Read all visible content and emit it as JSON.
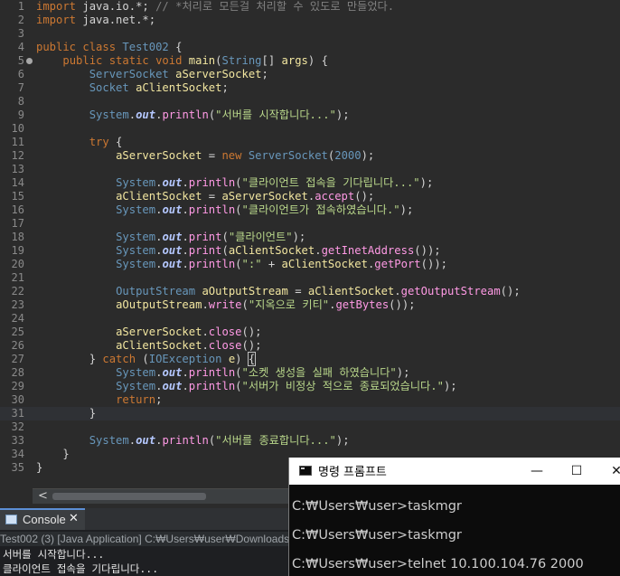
{
  "editor": {
    "lines": [
      {
        "n": "1",
        "tokens": [
          [
            "kw",
            "import"
          ],
          [
            "p",
            " java.io.*; "
          ],
          [
            "cm",
            "// *처리로 모든걸 처리할 수 있도로 만들었다."
          ]
        ]
      },
      {
        "n": "2",
        "tokens": [
          [
            "kw",
            "import"
          ],
          [
            "p",
            " java.net.*;"
          ]
        ]
      },
      {
        "n": "3",
        "tokens": []
      },
      {
        "n": "4",
        "tokens": [
          [
            "kw",
            "public class "
          ],
          [
            "cls",
            "Test002"
          ],
          [
            "p",
            " {"
          ]
        ]
      },
      {
        "n": "5",
        "fold": true,
        "tokens": [
          [
            "p",
            "    "
          ],
          [
            "kw",
            "public static void "
          ],
          [
            "id",
            "main"
          ],
          [
            "p",
            "("
          ],
          [
            "cls",
            "String"
          ],
          [
            "p",
            "[] "
          ],
          [
            "id",
            "args"
          ],
          [
            "p",
            ") {"
          ]
        ]
      },
      {
        "n": "6",
        "tokens": [
          [
            "p",
            "        "
          ],
          [
            "cls",
            "ServerSocket"
          ],
          [
            "p",
            " "
          ],
          [
            "id",
            "aServerSocket"
          ],
          [
            "p",
            ";"
          ]
        ]
      },
      {
        "n": "7",
        "tokens": [
          [
            "p",
            "        "
          ],
          [
            "cls",
            "Socket"
          ],
          [
            "p",
            " "
          ],
          [
            "id",
            "aClientSocket"
          ],
          [
            "p",
            ";"
          ]
        ]
      },
      {
        "n": "8",
        "tokens": []
      },
      {
        "n": "9",
        "tokens": [
          [
            "p",
            "        "
          ],
          [
            "cls",
            "System"
          ],
          [
            "p",
            "."
          ],
          [
            "fld",
            "out"
          ],
          [
            "p",
            "."
          ],
          [
            "mth",
            "println"
          ],
          [
            "p",
            "("
          ],
          [
            "str",
            "\"서버를 시작합니다...\""
          ],
          [
            "p",
            ");"
          ]
        ]
      },
      {
        "n": "10",
        "tokens": []
      },
      {
        "n": "11",
        "tokens": [
          [
            "p",
            "        "
          ],
          [
            "kw",
            "try"
          ],
          [
            "p",
            " {"
          ]
        ]
      },
      {
        "n": "12",
        "tokens": [
          [
            "p",
            "            "
          ],
          [
            "id",
            "aServerSocket"
          ],
          [
            "p",
            " = "
          ],
          [
            "kw",
            "new "
          ],
          [
            "cls",
            "ServerSocket"
          ],
          [
            "p",
            "("
          ],
          [
            "num",
            "2000"
          ],
          [
            "p",
            ");"
          ]
        ]
      },
      {
        "n": "13",
        "tokens": []
      },
      {
        "n": "14",
        "tokens": [
          [
            "p",
            "            "
          ],
          [
            "cls",
            "System"
          ],
          [
            "p",
            "."
          ],
          [
            "fld",
            "out"
          ],
          [
            "p",
            "."
          ],
          [
            "mth",
            "println"
          ],
          [
            "p",
            "("
          ],
          [
            "str",
            "\"클라이언트 접속을 기다립니다...\""
          ],
          [
            "p",
            ");"
          ]
        ]
      },
      {
        "n": "15",
        "tokens": [
          [
            "p",
            "            "
          ],
          [
            "id",
            "aClientSocket"
          ],
          [
            "p",
            " = "
          ],
          [
            "id",
            "aServerSocket"
          ],
          [
            "p",
            "."
          ],
          [
            "mth",
            "accept"
          ],
          [
            "p",
            "();"
          ]
        ]
      },
      {
        "n": "16",
        "tokens": [
          [
            "p",
            "            "
          ],
          [
            "cls",
            "System"
          ],
          [
            "p",
            "."
          ],
          [
            "fld",
            "out"
          ],
          [
            "p",
            "."
          ],
          [
            "mth",
            "println"
          ],
          [
            "p",
            "("
          ],
          [
            "str",
            "\"클라이언트가 접속하였습니다.\""
          ],
          [
            "p",
            ");"
          ]
        ]
      },
      {
        "n": "17",
        "tokens": []
      },
      {
        "n": "18",
        "tokens": [
          [
            "p",
            "            "
          ],
          [
            "cls",
            "System"
          ],
          [
            "p",
            "."
          ],
          [
            "fld",
            "out"
          ],
          [
            "p",
            "."
          ],
          [
            "mth",
            "print"
          ],
          [
            "p",
            "("
          ],
          [
            "str",
            "\"클라이언트\""
          ],
          [
            "p",
            ");"
          ]
        ]
      },
      {
        "n": "19",
        "tokens": [
          [
            "p",
            "            "
          ],
          [
            "cls",
            "System"
          ],
          [
            "p",
            "."
          ],
          [
            "fld",
            "out"
          ],
          [
            "p",
            "."
          ],
          [
            "mth",
            "print"
          ],
          [
            "p",
            "("
          ],
          [
            "id",
            "aClientSocket"
          ],
          [
            "p",
            "."
          ],
          [
            "mth",
            "getInetAddress"
          ],
          [
            "p",
            "());"
          ]
        ]
      },
      {
        "n": "20",
        "tokens": [
          [
            "p",
            "            "
          ],
          [
            "cls",
            "System"
          ],
          [
            "p",
            "."
          ],
          [
            "fld",
            "out"
          ],
          [
            "p",
            "."
          ],
          [
            "mth",
            "println"
          ],
          [
            "p",
            "("
          ],
          [
            "str",
            "\":\""
          ],
          [
            "p",
            " + "
          ],
          [
            "id",
            "aClientSocket"
          ],
          [
            "p",
            "."
          ],
          [
            "mth",
            "getPort"
          ],
          [
            "p",
            "());"
          ]
        ]
      },
      {
        "n": "21",
        "tokens": []
      },
      {
        "n": "22",
        "tokens": [
          [
            "p",
            "            "
          ],
          [
            "cls",
            "OutputStream"
          ],
          [
            "p",
            " "
          ],
          [
            "id",
            "aOutputStream"
          ],
          [
            "p",
            " = "
          ],
          [
            "id",
            "aClientSocket"
          ],
          [
            "p",
            "."
          ],
          [
            "mth",
            "getOutputStream"
          ],
          [
            "p",
            "();"
          ]
        ]
      },
      {
        "n": "23",
        "tokens": [
          [
            "p",
            "            "
          ],
          [
            "id",
            "aOutputStream"
          ],
          [
            "p",
            "."
          ],
          [
            "mth",
            "write"
          ],
          [
            "p",
            "("
          ],
          [
            "str",
            "\"지옥으로 키티\""
          ],
          [
            "p",
            "."
          ],
          [
            "mth",
            "getBytes"
          ],
          [
            "p",
            "());"
          ]
        ]
      },
      {
        "n": "24",
        "tokens": []
      },
      {
        "n": "25",
        "tokens": [
          [
            "p",
            "            "
          ],
          [
            "id",
            "aServerSocket"
          ],
          [
            "p",
            "."
          ],
          [
            "mth",
            "close"
          ],
          [
            "p",
            "();"
          ]
        ]
      },
      {
        "n": "26",
        "tokens": [
          [
            "p",
            "            "
          ],
          [
            "id",
            "aClientSocket"
          ],
          [
            "p",
            "."
          ],
          [
            "mth",
            "close"
          ],
          [
            "p",
            "();"
          ]
        ]
      },
      {
        "n": "27",
        "tokens": [
          [
            "p",
            "        } "
          ],
          [
            "kw",
            "catch"
          ],
          [
            "p",
            " ("
          ],
          [
            "cls",
            "IOException"
          ],
          [
            "p",
            " "
          ],
          [
            "id",
            "e"
          ],
          [
            "p",
            ") "
          ],
          [
            "br",
            "{"
          ]
        ]
      },
      {
        "n": "28",
        "tokens": [
          [
            "p",
            "            "
          ],
          [
            "cls",
            "System"
          ],
          [
            "p",
            "."
          ],
          [
            "fld",
            "out"
          ],
          [
            "p",
            "."
          ],
          [
            "mth",
            "println"
          ],
          [
            "p",
            "("
          ],
          [
            "str",
            "\"소켓 생성을 실패 하였습니다\""
          ],
          [
            "p",
            ");"
          ]
        ]
      },
      {
        "n": "29",
        "tokens": [
          [
            "p",
            "            "
          ],
          [
            "cls",
            "System"
          ],
          [
            "p",
            "."
          ],
          [
            "fld",
            "out"
          ],
          [
            "p",
            "."
          ],
          [
            "mth",
            "println"
          ],
          [
            "p",
            "("
          ],
          [
            "str",
            "\"서버가 비정상 적으로 종료되었습니다.\""
          ],
          [
            "p",
            ");"
          ]
        ]
      },
      {
        "n": "30",
        "tokens": [
          [
            "p",
            "            "
          ],
          [
            "kw",
            "return"
          ],
          [
            "p",
            ";"
          ]
        ]
      },
      {
        "n": "31",
        "current": true,
        "tokens": [
          [
            "p",
            "        }"
          ]
        ]
      },
      {
        "n": "32",
        "tokens": []
      },
      {
        "n": "33",
        "tokens": [
          [
            "p",
            "        "
          ],
          [
            "cls",
            "System"
          ],
          [
            "p",
            "."
          ],
          [
            "fld",
            "out"
          ],
          [
            "p",
            "."
          ],
          [
            "mth",
            "println"
          ],
          [
            "p",
            "("
          ],
          [
            "str",
            "\"서버를 종료합니다...\""
          ],
          [
            "p",
            ");"
          ]
        ]
      },
      {
        "n": "34",
        "tokens": [
          [
            "p",
            "    }"
          ]
        ]
      },
      {
        "n": "35",
        "tokens": [
          [
            "p",
            "}"
          ]
        ]
      }
    ]
  },
  "scrollbar": {
    "left_arrow": "<"
  },
  "console": {
    "tab_label": "Console",
    "close_glyph": "✕",
    "status": "Test002 (3) [Java Application] C:₩Users₩user₩Downloads₩",
    "output": [
      "서버를 시작합니다...",
      "클라이언트 접속을 기다립니다..."
    ]
  },
  "cmd": {
    "title": "명령 프롬프트",
    "minimize_glyph": "—",
    "maximize_glyph": "☐",
    "close_glyph": "✕",
    "lines": [
      "C:₩Users₩user>taskmgr",
      "",
      "C:₩Users₩user>taskmgr",
      "",
      "C:₩Users₩user>telnet 10.100.104.76 2000"
    ]
  },
  "colors": {
    "editor_bg": "#2b2b2b",
    "keyword": "#cc7832",
    "string": "#b8d68a",
    "class": "#6897bb",
    "cmd_bg": "#0c0c0c"
  }
}
